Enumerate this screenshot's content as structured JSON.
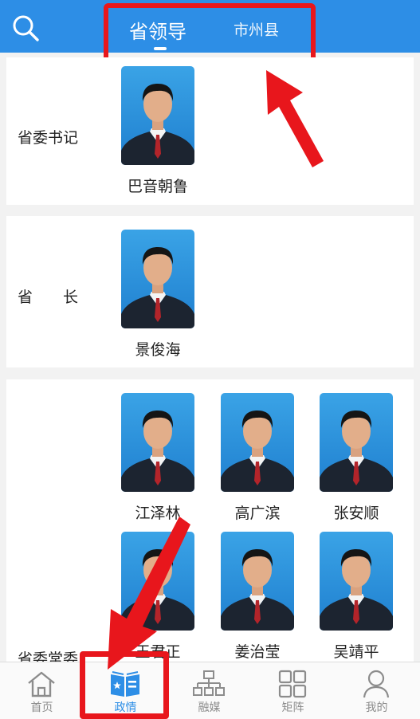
{
  "header": {
    "tabs": [
      {
        "label": "省领导",
        "active": true
      },
      {
        "label": "市州县",
        "active": false
      }
    ],
    "search_icon": "search-icon",
    "accent_color": "#2d8ee6"
  },
  "sections": [
    {
      "role": "省委书记",
      "people": [
        {
          "name": "巴音朝鲁"
        }
      ]
    },
    {
      "role": "省　　长",
      "people": [
        {
          "name": "景俊海"
        }
      ]
    },
    {
      "role": "省委常委",
      "people": [
        {
          "name": "江泽林"
        },
        {
          "name": "高广滨"
        },
        {
          "name": "张安顺"
        },
        {
          "name": "王君正"
        },
        {
          "name": "姜治莹"
        },
        {
          "name": "吴靖平"
        }
      ]
    }
  ],
  "bottom_nav": [
    {
      "label": "首页",
      "icon": "home-icon",
      "active": false
    },
    {
      "label": "政情",
      "icon": "book-icon",
      "active": true
    },
    {
      "label": "融媒",
      "icon": "org-chart-icon",
      "active": false
    },
    {
      "label": "矩阵",
      "icon": "grid-icon",
      "active": false
    },
    {
      "label": "我的",
      "icon": "user-icon",
      "active": false
    }
  ],
  "annotation_color": "#e8161c"
}
